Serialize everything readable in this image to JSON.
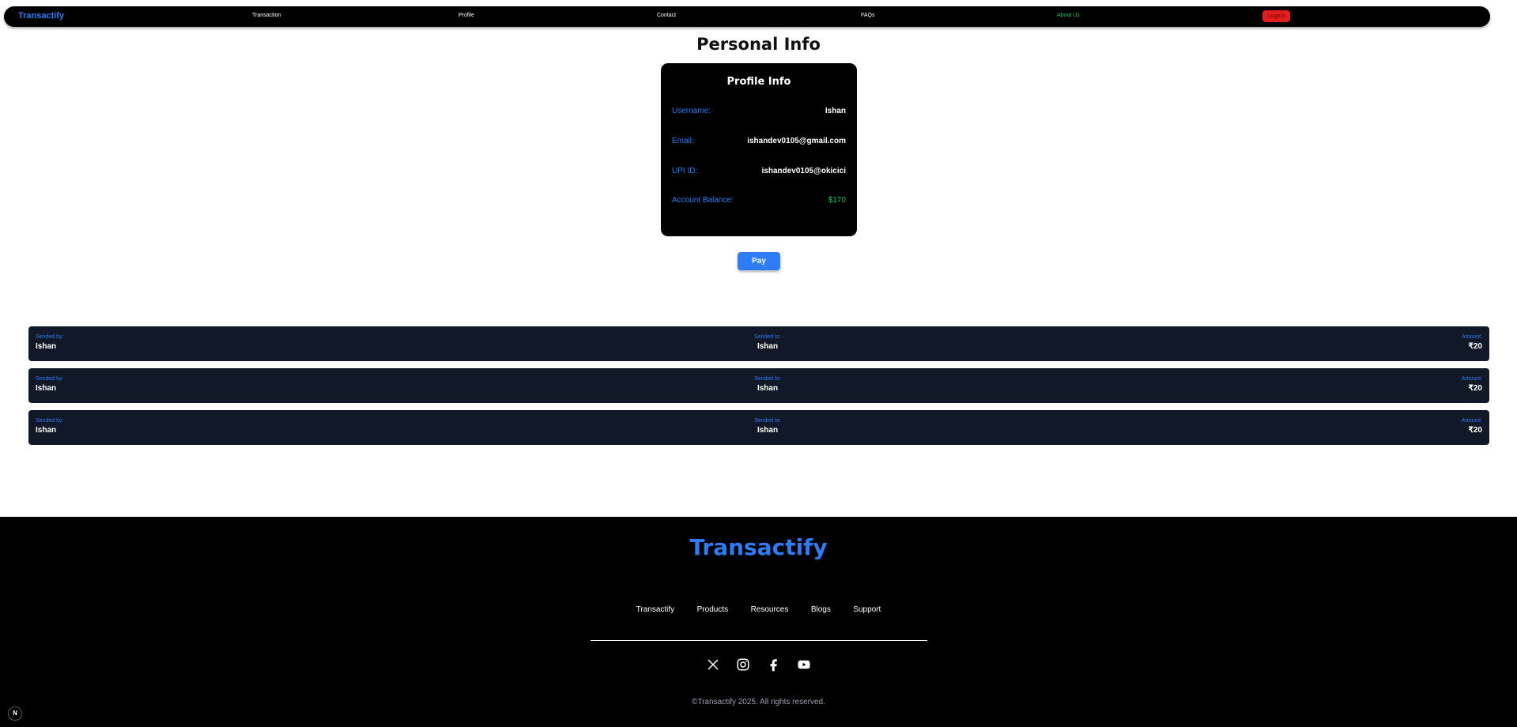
{
  "nav": {
    "brand": "Transactify",
    "links": [
      "Transaction",
      "Profile",
      "Contact",
      "FAQs",
      "About Us"
    ],
    "logout": "Logout"
  },
  "page": {
    "title": "Personal Info"
  },
  "profile": {
    "title": "Profile Info",
    "fields": [
      {
        "label": "Username:",
        "value": "Ishan"
      },
      {
        "label": "Email:",
        "value": "ishandev0105@gmail.com"
      },
      {
        "label": "UPI ID:",
        "value": "ishandev0105@okicici"
      },
      {
        "label": "Account Balance:",
        "value": "$170"
      }
    ],
    "pay_label": "Pay"
  },
  "transactions": [
    {
      "sent_by_label": "Sended by:",
      "sent_by": "Ishan",
      "sent_to_label": "Sended to:",
      "sent_to": "Ishan",
      "amount_label": "Amount:",
      "amount": "₹20"
    },
    {
      "sent_by_label": "Sended by:",
      "sent_by": "Ishan",
      "sent_to_label": "Sended to:",
      "sent_to": "Ishan",
      "amount_label": "Amount:",
      "amount": "₹20"
    },
    {
      "sent_by_label": "Sended by:",
      "sent_by": "Ishan",
      "sent_to_label": "Sended to:",
      "sent_to": "Ishan",
      "amount_label": "Amount:",
      "amount": "₹20"
    }
  ],
  "footer": {
    "brand": "Transactify",
    "links": [
      "Transactify",
      "Products",
      "Resources",
      "Blogs",
      "Support"
    ],
    "socials": [
      "x-icon",
      "instagram-icon",
      "facebook-icon",
      "youtube-icon"
    ],
    "copyright": "©Transactify 2025. All rights reserved.",
    "badge": "N"
  },
  "colors": {
    "accent": "#2f7cf6",
    "positive": "#22c55e",
    "danger": "#e11d1d",
    "row_bg": "#111827"
  }
}
